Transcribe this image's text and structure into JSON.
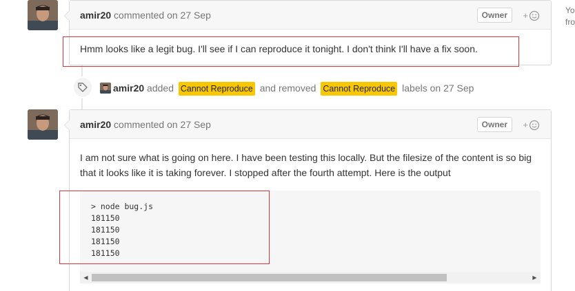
{
  "comments": [
    {
      "author": "amir20",
      "meta": "commented on 27 Sep",
      "badge": "Owner",
      "reaction_plus": "+",
      "body": "Hmm looks like a legit bug. I'll see if I can reproduce it tonight. I don't think I'll have a fix soon."
    },
    {
      "author": "amir20",
      "meta": "commented on 27 Sep",
      "badge": "Owner",
      "reaction_plus": "+",
      "body": "I am not sure what is going on here. I have been testing this locally. But the filesize of the content is so big that it looks like it is taking forever. I stopped after the fourth attempt. Here is the output",
      "code": "> node bug.js\n181150\n181150\n181150\n181150"
    }
  ],
  "event": {
    "actor": "amir20",
    "added_text": "added",
    "label_added": "Cannot Reproduce",
    "removed_text": "and removed",
    "label_removed": "Cannot Reproduce",
    "suffix": "labels on 27 Sep",
    "label_color": "#f9c700"
  },
  "sidebar": {
    "line1": "Yo",
    "line2": "fro"
  },
  "icons": {
    "tag": "tag-icon",
    "reaction": "smiley-icon",
    "scroll_left": "scroll-left-arrow",
    "scroll_right": "scroll-right-arrow"
  },
  "colors": {
    "highlight_box": "#d9343a",
    "header_bg": "#f7f7f7",
    "border": "#d8d8d8"
  }
}
